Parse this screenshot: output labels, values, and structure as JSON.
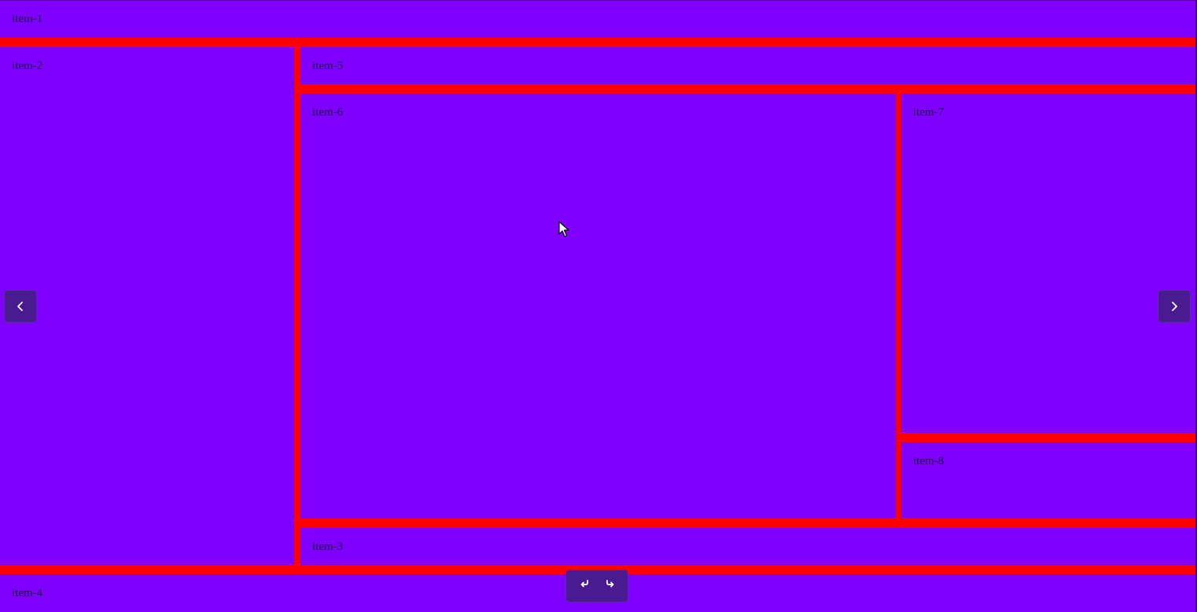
{
  "colors": {
    "cell": "#8000ff",
    "gutter": "#ff0000",
    "control": "#4a1a90"
  },
  "items": {
    "item1": "item-1",
    "item2": "item-2",
    "item3": "item-3",
    "item4": "item-4",
    "item5": "item-5",
    "item6": "item-6",
    "item7": "item-7",
    "item8": "item-8"
  },
  "controls": {
    "prev_icon": "chevron-left-icon",
    "next_icon": "chevron-right-icon",
    "undo_icon": "undo-arrow-icon",
    "redo_icon": "redo-arrow-icon"
  }
}
